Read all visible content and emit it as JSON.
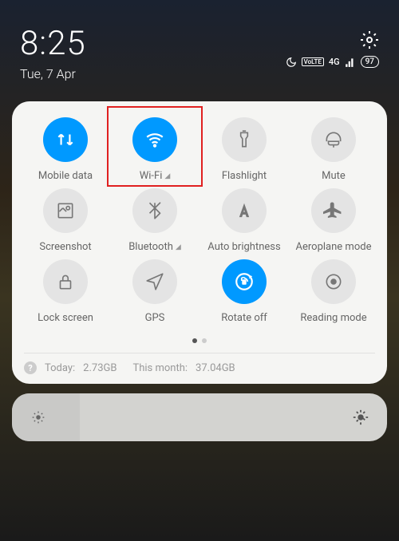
{
  "status": {
    "time": "8:25",
    "date": "Tue, 7 Apr",
    "network_badge": "4G",
    "lte_badge": "VoLTE",
    "battery_percent": "97"
  },
  "tiles": [
    {
      "id": "mobile-data",
      "label": "Mobile data",
      "active": true,
      "chevron": false,
      "highlighted": false
    },
    {
      "id": "wifi",
      "label": "Wi-Fi",
      "active": true,
      "chevron": true,
      "highlighted": true
    },
    {
      "id": "flashlight",
      "label": "Flashlight",
      "active": false,
      "chevron": false,
      "highlighted": false
    },
    {
      "id": "mute",
      "label": "Mute",
      "active": false,
      "chevron": false,
      "highlighted": false
    },
    {
      "id": "screenshot",
      "label": "Screenshot",
      "active": false,
      "chevron": false,
      "highlighted": false
    },
    {
      "id": "bluetooth",
      "label": "Bluetooth",
      "active": false,
      "chevron": true,
      "highlighted": false
    },
    {
      "id": "auto-brightness",
      "label": "Auto brightness",
      "active": false,
      "chevron": false,
      "highlighted": false
    },
    {
      "id": "aeroplane",
      "label": "Aeroplane mode",
      "active": false,
      "chevron": false,
      "highlighted": false
    },
    {
      "id": "lock-screen",
      "label": "Lock screen",
      "active": false,
      "chevron": false,
      "highlighted": false
    },
    {
      "id": "gps",
      "label": "GPS",
      "active": false,
      "chevron": false,
      "highlighted": false
    },
    {
      "id": "rotate",
      "label": "Rotate off",
      "active": true,
      "chevron": false,
      "highlighted": false
    },
    {
      "id": "reading",
      "label": "Reading mode",
      "active": false,
      "chevron": false,
      "highlighted": false
    }
  ],
  "usage": {
    "today_label": "Today:",
    "today_value": "2.73GB",
    "month_label": "This month:",
    "month_value": "37.04GB"
  },
  "colors": {
    "active": "#0099ff",
    "highlight": "#e02020"
  }
}
